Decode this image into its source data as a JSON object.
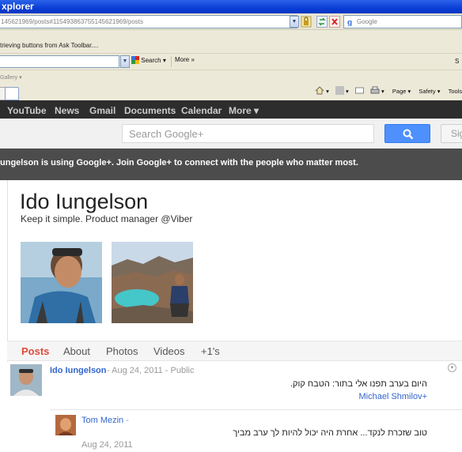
{
  "window": {
    "title": "xplorer"
  },
  "addressbar": {
    "url": "145621969/posts#115493863755145621969/posts",
    "search_placeholder": "Google"
  },
  "ask_toolbar": {
    "status": "trieving buttons from Ask Toolbar...."
  },
  "toolbar": {
    "search_label": "Search",
    "more_label": "More »",
    "edge_label": "S"
  },
  "favorites": {
    "gallery_label": "Gallery ▾"
  },
  "commandbar": {
    "page_label": "Page ▾",
    "safety_label": "Safety ▾",
    "tools_label": "Tools"
  },
  "gbar": {
    "items": [
      "YouTube",
      "News",
      "Gmail",
      "Documents",
      "Calendar",
      "More ▾"
    ]
  },
  "header": {
    "search_placeholder": "Search Google+",
    "signin_label": "Sig"
  },
  "banner": {
    "text": "ungelson is using Google+. Join Google+ to connect with the people who matter most."
  },
  "profile": {
    "name": "Ido Iungelson",
    "tagline": "Keep it simple. Product manager @Viber"
  },
  "tabs": [
    "Posts",
    "About",
    "Photos",
    "Videos",
    "+1's"
  ],
  "post": {
    "author": "Ido Iungelson",
    "meta": "-  Aug 24, 2011  -  Public",
    "body": "היום בערב תפנו אלי בתור: הטבח קוק.",
    "mention": "Michael Shmilov+"
  },
  "comment": {
    "author": "Tom Mezin",
    "separator": "-",
    "body": "טוב שזכרת לנקד... אחרת היה יכול להיות לך ערב מביך",
    "date": "Aug 24, 2011"
  },
  "colors": {
    "gbar": "#2d2d2d",
    "banner": "#4c4c4c",
    "accent_red": "#dd4b39",
    "link_blue": "#3366cc",
    "search_button": "#4d90fe"
  }
}
